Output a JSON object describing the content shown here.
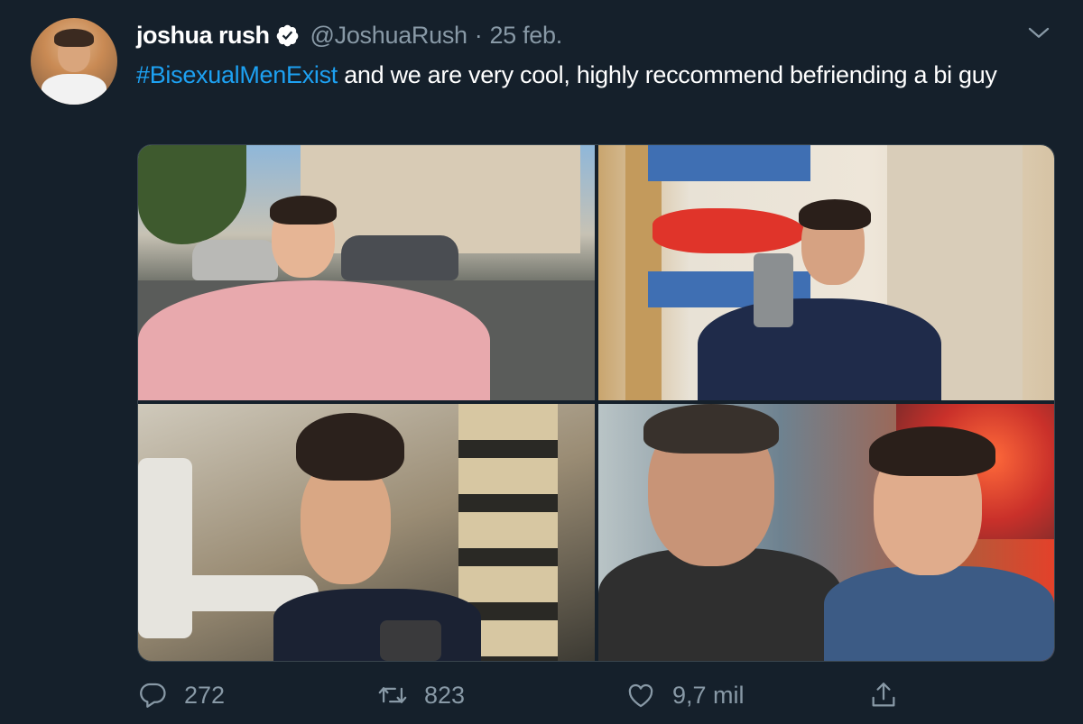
{
  "author": {
    "name": "joshua rush",
    "handle": "@JoshuaRush",
    "separator": "·",
    "date": "25 feb."
  },
  "tweet": {
    "hashtag": "#BisexualMenExist",
    "text": " and we are very cool, highly reccommend befriending a bi guy"
  },
  "icons": {
    "verified": "verified-badge-icon",
    "menu": "chevron-down-icon",
    "reply": "reply-icon",
    "retweet": "retweet-icon",
    "like": "heart-icon",
    "share": "share-icon"
  },
  "actions": {
    "replies": "272",
    "retweets": "823",
    "likes": "9,7 mil"
  },
  "colors": {
    "background": "#15202b",
    "accent": "#1da1f2",
    "secondary_text": "#8899a6"
  }
}
